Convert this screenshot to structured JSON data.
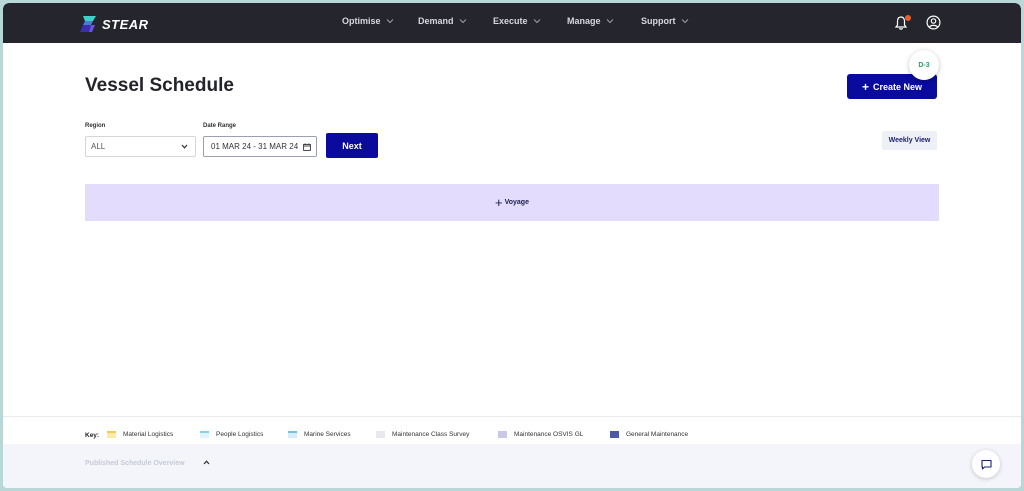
{
  "app": {
    "logo_text": "STEAR"
  },
  "nav": {
    "items": [
      {
        "label": "Optimise"
      },
      {
        "label": "Demand"
      },
      {
        "label": "Execute"
      },
      {
        "label": "Manage"
      },
      {
        "label": "Support"
      }
    ],
    "notification_icon": "bell-icon",
    "user_icon": "user-circle-icon"
  },
  "page": {
    "title": "Vessel Schedule",
    "create_label": "Create New",
    "badge": "D-3"
  },
  "filters": {
    "region_label": "Region",
    "region_value": "ALL",
    "date_label": "Date Range",
    "date_value": "01 MAR 24 - 31 MAR 24",
    "next_label": "Next",
    "weekly_label": "Weekly View"
  },
  "voyage": {
    "label": "Voyage"
  },
  "key": {
    "label": "Key:",
    "items": [
      {
        "label": "Material Logistics",
        "color": "#fbeaa6",
        "border": "#f0cc52"
      },
      {
        "label": "People Logistics",
        "color": "#e1f3fb",
        "border": "#8ecfe8"
      },
      {
        "label": "Marine Services",
        "color": "#d7eefa",
        "border": "#7bbfe0"
      },
      {
        "label": "Maintenance Class Survey",
        "color": "#e7e9ef",
        "border": "#e7e9ef"
      },
      {
        "label": "Maintenance OSVIS GL",
        "color": "#c9c9e6",
        "border": "#c9c9e6"
      },
      {
        "label": "General Maintenance",
        "color": "#4f5aa6",
        "border": "#4f5aa6"
      }
    ]
  },
  "bottom": {
    "published_label": "Published Schedule Overview"
  },
  "colors": {
    "primary": "#0a0a9c",
    "topbar": "#24252d",
    "voyage_bg": "#e3dcfc",
    "badge_text": "#2f9a68",
    "notification_dot": "#e8612c"
  }
}
